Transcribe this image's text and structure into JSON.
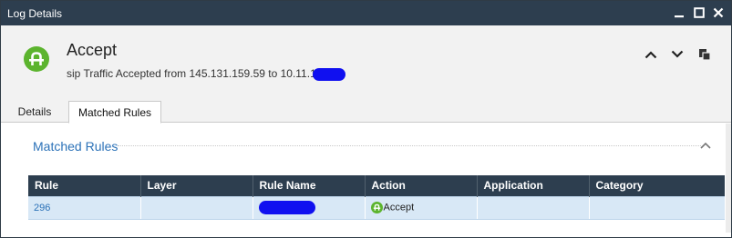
{
  "window": {
    "title": "Log Details"
  },
  "header": {
    "title": "Accept",
    "description": "sip Traffic Accepted from 145.131.159.59 to 10.11.1",
    "status_color": "#5cb42e"
  },
  "tabs": [
    {
      "label": "Details"
    },
    {
      "label": "Matched Rules"
    }
  ],
  "section": {
    "title": "Matched Rules"
  },
  "table": {
    "columns": [
      "Rule",
      "Layer",
      "Rule Name",
      "Action",
      "Application",
      "Category"
    ],
    "rows": [
      {
        "rule": "296",
        "layer": "",
        "rule_name": "",
        "action": "Accept",
        "application": "",
        "category": ""
      }
    ]
  },
  "colors": {
    "titlebar": "#2d3e4f",
    "accent": "#2c72b8",
    "row_highlight": "#d8e8f6",
    "redaction": "#1010f0"
  }
}
